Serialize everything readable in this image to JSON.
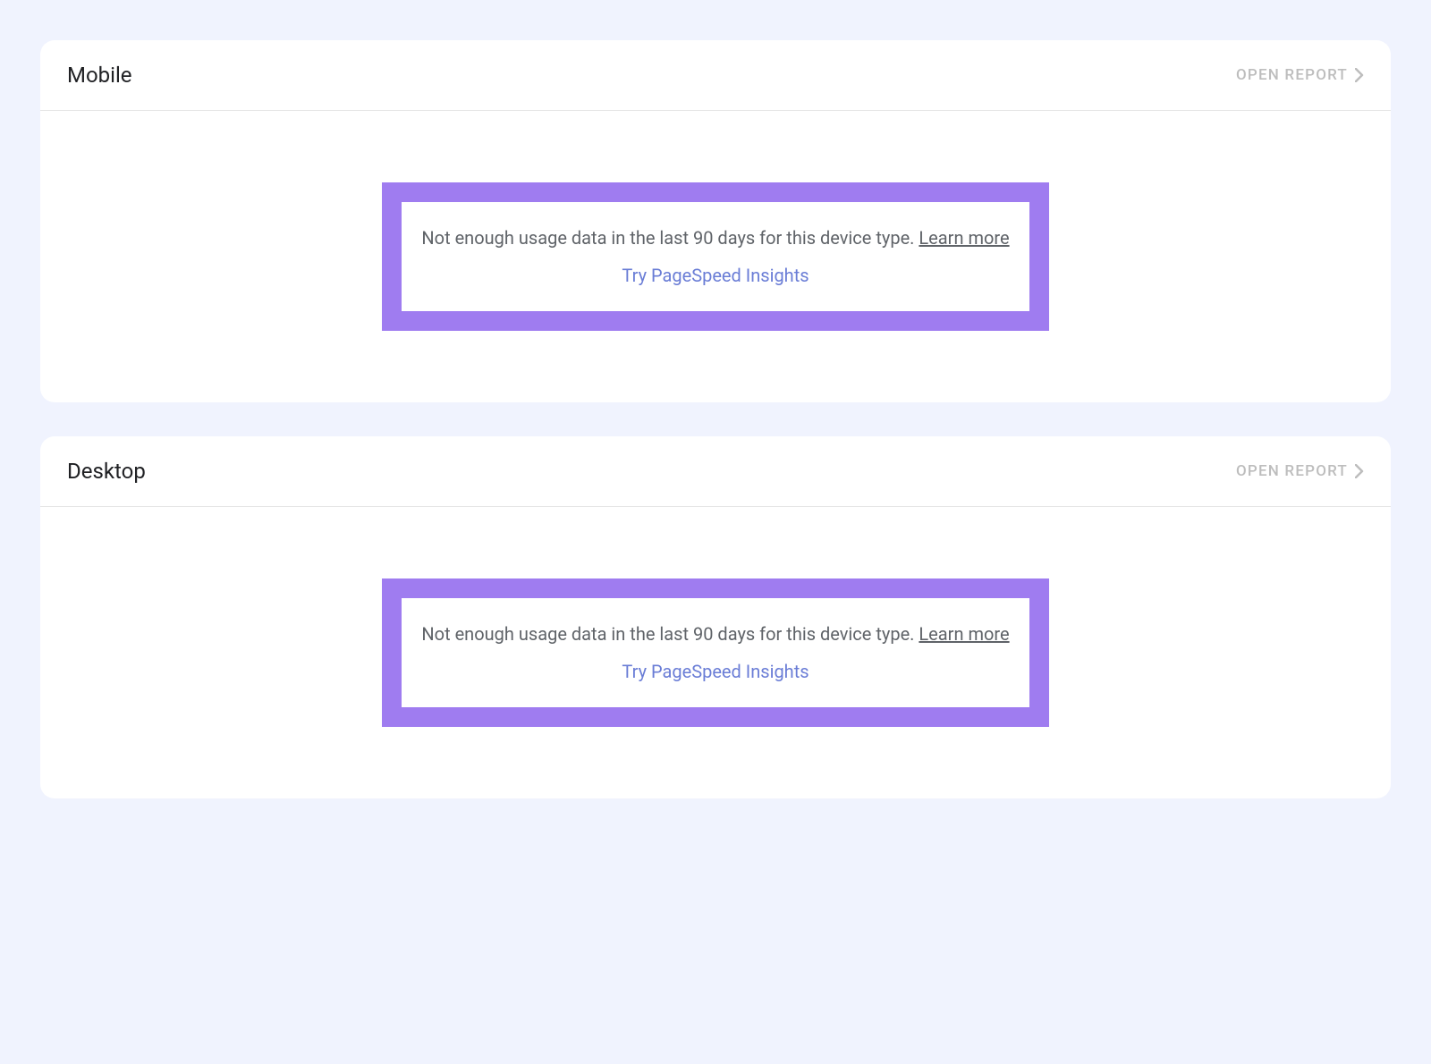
{
  "cards": {
    "mobile": {
      "title": "Mobile",
      "open_report_label": "OPEN REPORT",
      "message_text": "Not enough usage data in the last 90 days for this device type. ",
      "learn_more_label": "Learn more",
      "try_link_label": "Try PageSpeed Insights"
    },
    "desktop": {
      "title": "Desktop",
      "open_report_label": "OPEN REPORT",
      "message_text": "Not enough usage data in the last 90 days for this device type. ",
      "learn_more_label": "Learn more",
      "try_link_label": "Try PageSpeed Insights"
    }
  }
}
